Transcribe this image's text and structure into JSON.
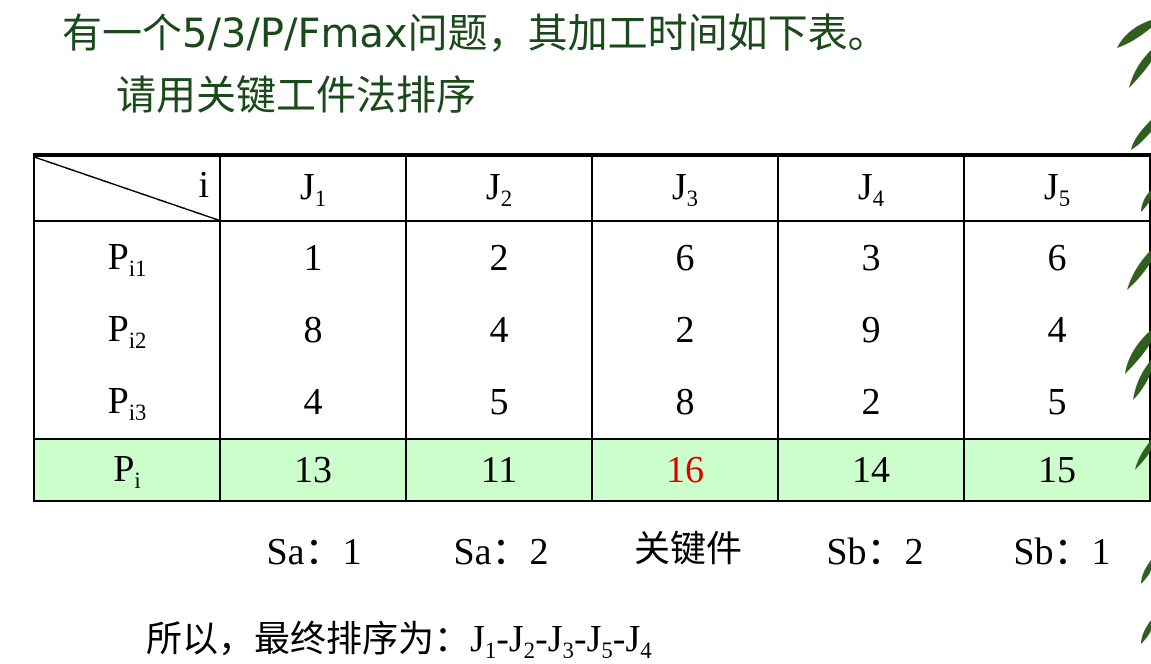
{
  "title": {
    "prefix": "有一个",
    "code": "5/3/P/Fmax",
    "suffix": "问题，其加工时间如下表。"
  },
  "subtitle": "请用关键工件法排序",
  "table": {
    "corner_label": "i",
    "jobs": [
      {
        "main": "J",
        "sub": "1"
      },
      {
        "main": "J",
        "sub": "2"
      },
      {
        "main": "J",
        "sub": "3"
      },
      {
        "main": "J",
        "sub": "4"
      },
      {
        "main": "J",
        "sub": "5"
      }
    ],
    "rows": [
      {
        "label_main": "P",
        "label_sub": "i1",
        "values": [
          "1",
          "2",
          "6",
          "3",
          "6"
        ]
      },
      {
        "label_main": "P",
        "label_sub": "i2",
        "values": [
          "8",
          "4",
          "2",
          "9",
          "4"
        ]
      },
      {
        "label_main": "P",
        "label_sub": "i3",
        "values": [
          "4",
          "5",
          "8",
          "2",
          "5"
        ]
      }
    ],
    "sum_row": {
      "label_main": "P",
      "label_sub": "i",
      "values": [
        "13",
        "11",
        "16",
        "14",
        "15"
      ]
    },
    "highlight_color": "#e00000",
    "sum_row_bg": "#ccffcc"
  },
  "notes": [
    "Sa：1",
    "Sa：2",
    "关键件",
    "Sb：2",
    "Sb：1"
  ],
  "result": {
    "label": "所以，最终排序为：",
    "sequence": [
      {
        "main": "J",
        "sub": "1"
      },
      {
        "main": "J",
        "sub": "2"
      },
      {
        "main": "J",
        "sub": "3"
      },
      {
        "main": "J",
        "sub": "5"
      },
      {
        "main": "J",
        "sub": "4"
      }
    ],
    "separator": "-"
  },
  "colors": {
    "title_text": "#1a4a1a",
    "decoration": "#2f5f1f"
  },
  "decoration_icon": "bamboo-leaves-icon"
}
